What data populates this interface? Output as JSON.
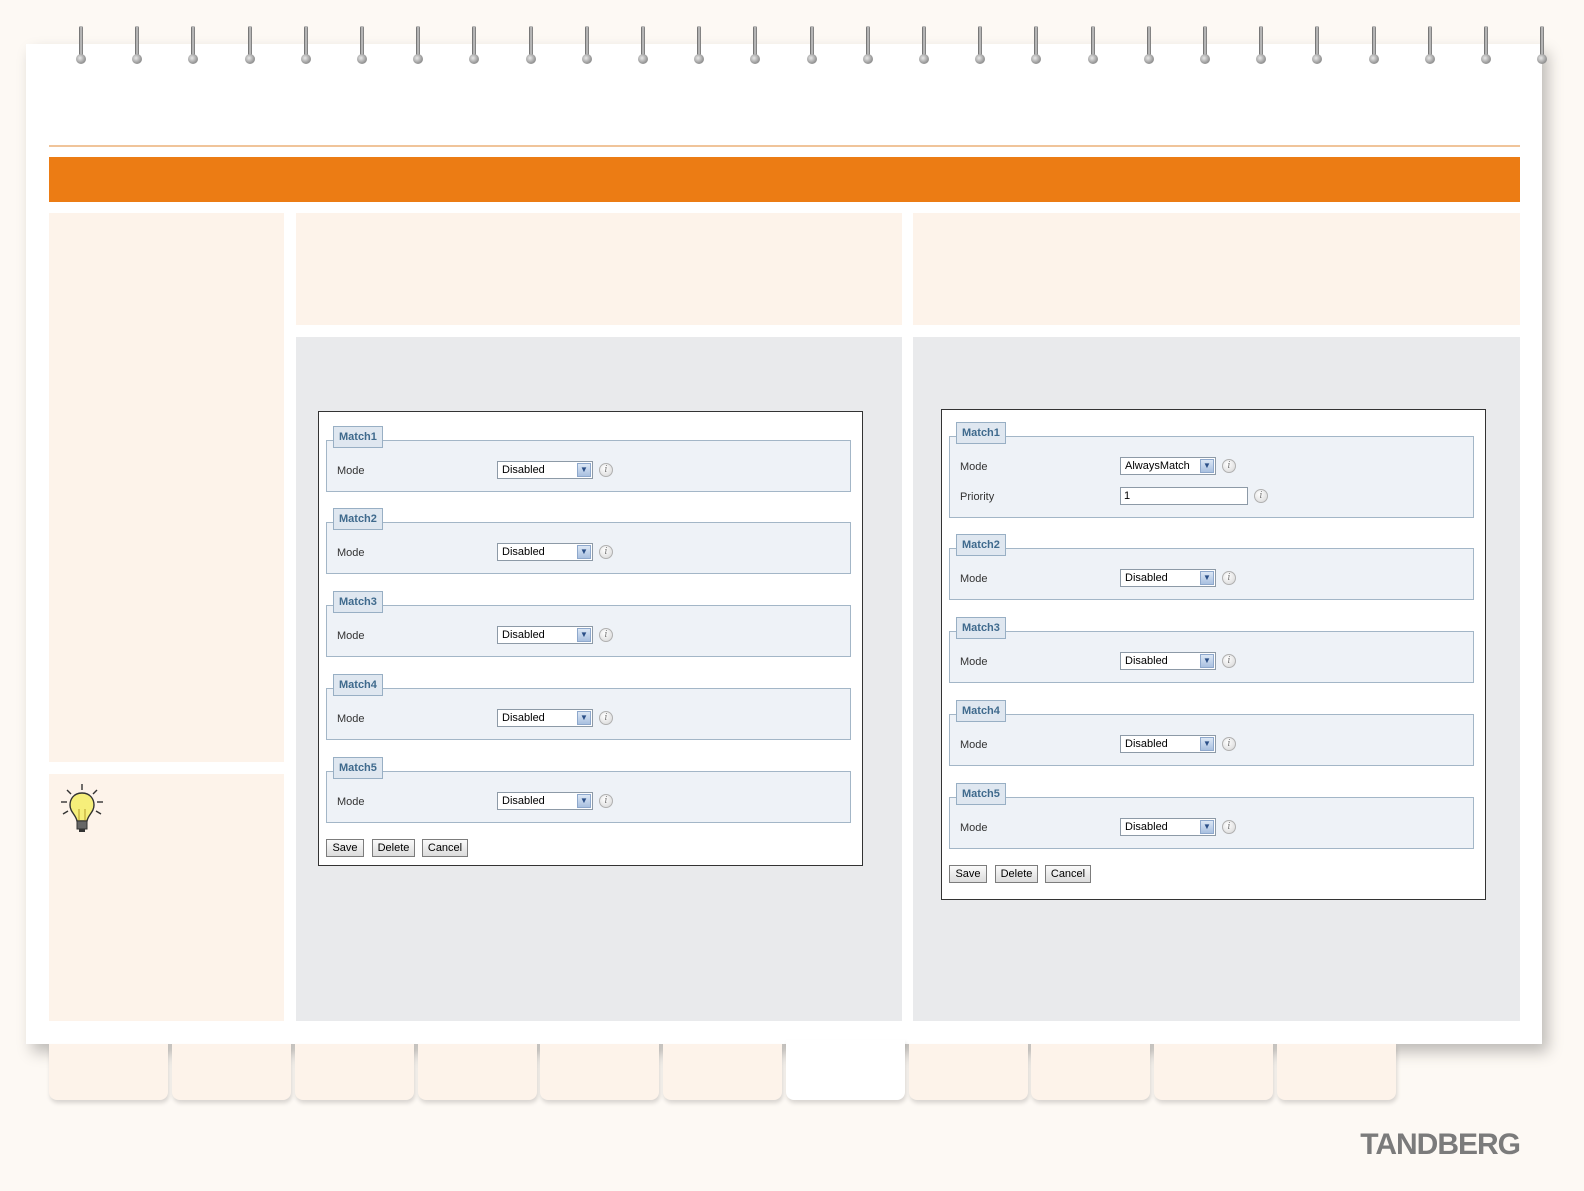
{
  "left_dialog": {
    "groups": [
      {
        "legend": "Match1",
        "rows": [
          {
            "label": "Mode",
            "type": "select",
            "value": "Disabled"
          }
        ]
      },
      {
        "legend": "Match2",
        "rows": [
          {
            "label": "Mode",
            "type": "select",
            "value": "Disabled"
          }
        ]
      },
      {
        "legend": "Match3",
        "rows": [
          {
            "label": "Mode",
            "type": "select",
            "value": "Disabled"
          }
        ]
      },
      {
        "legend": "Match4",
        "rows": [
          {
            "label": "Mode",
            "type": "select",
            "value": "Disabled"
          }
        ]
      },
      {
        "legend": "Match5",
        "rows": [
          {
            "label": "Mode",
            "type": "select",
            "value": "Disabled"
          }
        ]
      }
    ],
    "buttons": {
      "save": "Save",
      "delete": "Delete",
      "cancel": "Cancel"
    }
  },
  "right_dialog": {
    "groups": [
      {
        "legend": "Match1",
        "rows": [
          {
            "label": "Mode",
            "type": "select",
            "value": "AlwaysMatch"
          },
          {
            "label": "Priority",
            "type": "text",
            "value": "1"
          }
        ]
      },
      {
        "legend": "Match2",
        "rows": [
          {
            "label": "Mode",
            "type": "select",
            "value": "Disabled"
          }
        ]
      },
      {
        "legend": "Match3",
        "rows": [
          {
            "label": "Mode",
            "type": "select",
            "value": "Disabled"
          }
        ]
      },
      {
        "legend": "Match4",
        "rows": [
          {
            "label": "Mode",
            "type": "select",
            "value": "Disabled"
          }
        ]
      },
      {
        "legend": "Match5",
        "rows": [
          {
            "label": "Mode",
            "type": "select",
            "value": "Disabled"
          }
        ]
      }
    ],
    "buttons": {
      "save": "Save",
      "delete": "Delete",
      "cancel": "Cancel"
    }
  },
  "brand": {
    "logo_text": "TANDBERG"
  },
  "icons": {
    "info": "info-icon",
    "dropdown": "chevron-down-icon",
    "tip": "lightbulb-icon"
  },
  "colors": {
    "accent": "#ec7c14",
    "legend_text": "#3f6a8d",
    "panel": "#fdf3ea",
    "content_bg": "#e9eaec"
  }
}
